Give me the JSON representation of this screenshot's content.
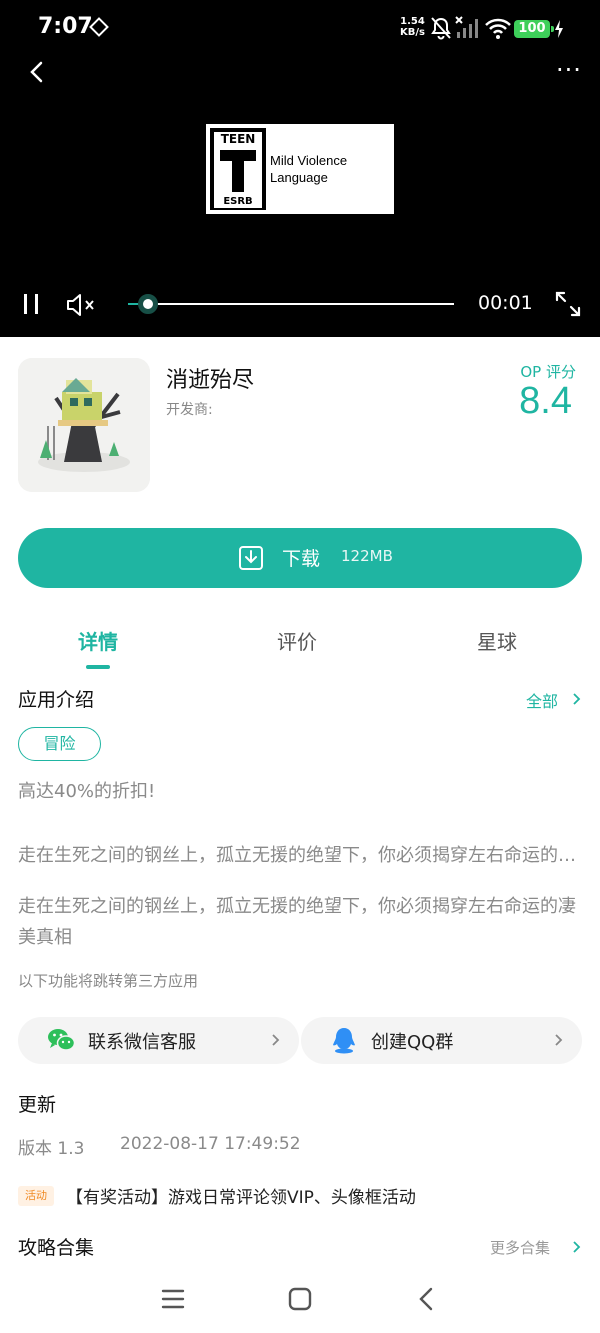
{
  "status_bar": {
    "time": "7:07",
    "net_speed_value": "1.54",
    "net_speed_unit": "KB/s",
    "battery": "100",
    "icons": [
      "diamond-icon",
      "bell-off-icon",
      "no-signal-icon",
      "wifi-icon",
      "charging-icon"
    ]
  },
  "video": {
    "rating": {
      "top_label": "TEEN",
      "letter": "T",
      "bottom_label": "ESRB",
      "descriptors": [
        "Mild Violence",
        "Language"
      ]
    },
    "elapsed": "00:01",
    "progress": 0.06,
    "paused_state_icon": "pause-icon",
    "muted": true
  },
  "app": {
    "name": "消逝殆尽",
    "developer_label": "开发商:",
    "score_label": "OP 评分",
    "score": "8.4"
  },
  "download": {
    "label": "下载",
    "size": "122MB"
  },
  "tabs": [
    {
      "label": "详情",
      "active": true
    },
    {
      "label": "评价",
      "active": false
    },
    {
      "label": "星球",
      "active": false
    }
  ],
  "intro": {
    "title": "应用介绍",
    "see_all": "全部",
    "tag": "冒险",
    "promo": "高达40%的折扣!",
    "desc_collapsed": "走在生死之间的钢丝上，孤立无援的绝望下，你必须揭穿左右命运的凄美真相",
    "desc_full": "走在生死之间的钢丝上，孤立无援的绝望下，你必须揭穿左右命运的凄美真相",
    "third_party_note": "以下功能将跳转第三方应用"
  },
  "contacts": [
    {
      "label": "联系微信客服",
      "icon": "wechat-icon"
    },
    {
      "label": "创建QQ群",
      "icon": "qq-icon"
    }
  ],
  "update": {
    "title": "更新",
    "version": "版本 1.3",
    "date": "2022-08-17 17:49:52"
  },
  "activity": {
    "badge": "活动",
    "text": "【有奖活动】游戏日常评论领VIP、头像框活动"
  },
  "guides": {
    "title": "攻略合集",
    "more": "更多合集"
  },
  "colors": {
    "accent": "#1fb5a2",
    "activity": "#f08a24",
    "battery": "#3ecf5a"
  }
}
